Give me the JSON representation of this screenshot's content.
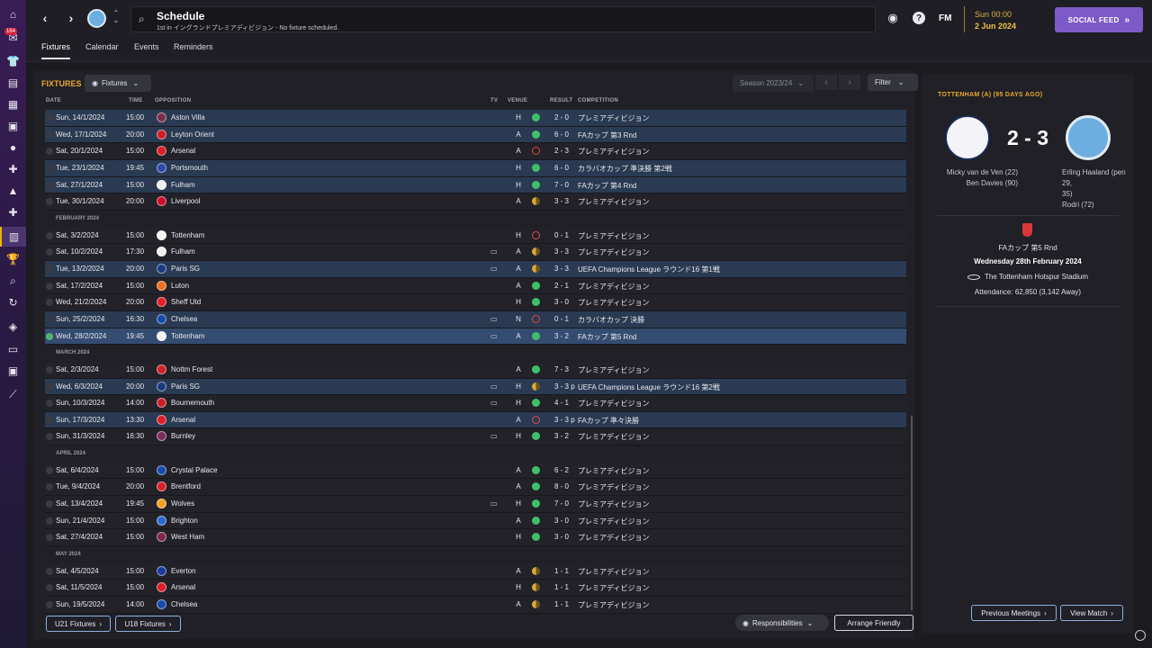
{
  "topbar": {
    "title": "Schedule",
    "subtitle": "1st in イングランドプレミアディビジョン - No fixture scheduled.",
    "fm_logo": "FM",
    "time": "Sun 00:00",
    "date": "2 Jun 2024",
    "social_feed": "SOCIAL FEED"
  },
  "rail": {
    "badge": "164"
  },
  "tabs": [
    "Fixtures",
    "Calendar",
    "Events",
    "Reminders"
  ],
  "fixtures": {
    "section_title": "FIXTURES",
    "view_dropdown": "Fixtures",
    "season": "Season 2023/24",
    "filter": "Filter",
    "columns": {
      "date": "DATE",
      "time": "TIME",
      "opposition": "OPPOSITION",
      "tv": "TV",
      "venue": "VENUE",
      "result": "RESULT",
      "competition": "COMPETITION"
    },
    "rows": [
      {
        "kind": "cup",
        "date": "Sun, 14/1/2024",
        "time": "15:00",
        "opp": "Aston Villa",
        "crest": "#7a2e4a",
        "tv": "",
        "venue": "H",
        "res": "w",
        "score": "2 - 0",
        "comp": "プレミアディビジョン"
      },
      {
        "kind": "cup",
        "date": "Wed, 17/1/2024",
        "time": "20:00",
        "opp": "Leyton Orient",
        "crest": "#c8202a",
        "tv": "",
        "venue": "A",
        "res": "w",
        "score": "6 - 0",
        "comp": "FAカップ 第3 Rnd"
      },
      {
        "kind": "norm",
        "date": "Sat, 20/1/2024",
        "time": "15:00",
        "opp": "Arsenal",
        "crest": "#d8202a",
        "tv": "",
        "venue": "A",
        "res": "l",
        "score": "2 - 3",
        "comp": "プレミアディビジョン"
      },
      {
        "kind": "cup",
        "date": "Tue, 23/1/2024",
        "time": "19:45",
        "opp": "Portsmouth",
        "crest": "#2a4aa8",
        "tv": "",
        "venue": "H",
        "res": "w",
        "score": "6 - 0",
        "comp": "カラバオカップ 準決勝 第2戦"
      },
      {
        "kind": "cup",
        "date": "Sat, 27/1/2024",
        "time": "15:00",
        "opp": "Fulham",
        "crest": "#f0f0f0",
        "tv": "",
        "venue": "H",
        "res": "w",
        "score": "7 - 0",
        "comp": "FAカップ 第4 Rnd"
      },
      {
        "kind": "norm",
        "date": "Tue, 30/1/2024",
        "time": "20:00",
        "opp": "Liverpool",
        "crest": "#c8102e",
        "tv": "",
        "venue": "A",
        "res": "d",
        "score": "3 - 3",
        "comp": "プレミアディビジョン"
      },
      {
        "kind": "month",
        "date": "FEBRUARY 2024"
      },
      {
        "kind": "norm",
        "date": "Sat, 3/2/2024",
        "time": "15:00",
        "opp": "Tottenham",
        "crest": "#f4f4f4",
        "tv": "",
        "venue": "H",
        "res": "l",
        "score": "0 - 1",
        "comp": "プレミアディビジョン"
      },
      {
        "kind": "norm",
        "date": "Sat, 10/2/2024",
        "time": "17:30",
        "opp": "Fulham",
        "crest": "#f0f0f0",
        "tv": "▭",
        "venue": "A",
        "res": "d",
        "score": "3 - 3",
        "comp": "プレミアディビジョン"
      },
      {
        "kind": "cup",
        "date": "Tue, 13/2/2024",
        "time": "20:00",
        "opp": "Paris SG",
        "crest": "#1a3a80",
        "tv": "▭",
        "venue": "A",
        "res": "d",
        "score": "3 - 3",
        "comp": "UEFA Champions League ラウンド16 第1戦"
      },
      {
        "kind": "norm",
        "date": "Sat, 17/2/2024",
        "time": "15:00",
        "opp": "Luton",
        "crest": "#f07020",
        "tv": "",
        "venue": "A",
        "res": "w",
        "score": "2 - 1",
        "comp": "プレミアディビジョン"
      },
      {
        "kind": "norm",
        "date": "Wed, 21/2/2024",
        "time": "20:00",
        "opp": "Sheff Utd",
        "crest": "#e0202a",
        "tv": "",
        "venue": "H",
        "res": "w",
        "score": "3 - 0",
        "comp": "プレミアディビジョン"
      },
      {
        "kind": "cup",
        "date": "Sun, 25/2/2024",
        "time": "16:30",
        "opp": "Chelsea",
        "crest": "#1a4aa8",
        "tv": "▭",
        "venue": "N",
        "res": "l",
        "score": "0 - 1",
        "comp": "カラバオカップ 決勝"
      },
      {
        "kind": "sel",
        "date": "Wed, 28/2/2024",
        "time": "19:45",
        "opp": "Tottenham",
        "crest": "#f4f4f4",
        "tv": "▭",
        "venue": "A",
        "res": "w",
        "score": "3 - 2",
        "comp": "FAカップ 第5 Rnd"
      },
      {
        "kind": "month",
        "date": "MARCH 2024"
      },
      {
        "kind": "norm",
        "date": "Sat, 2/3/2024",
        "time": "15:00",
        "opp": "Nottm Forest",
        "crest": "#d0202a",
        "tv": "",
        "venue": "A",
        "res": "w",
        "score": "7 - 3",
        "comp": "プレミアディビジョン"
      },
      {
        "kind": "cup",
        "date": "Wed, 6/3/2024",
        "time": "20:00",
        "opp": "Paris SG",
        "crest": "#1a3a80",
        "tv": "▭",
        "venue": "H",
        "res": "d",
        "score": "3 - 3 p",
        "comp": "UEFA Champions League ラウンド16 第2戦"
      },
      {
        "kind": "norm",
        "date": "Sun, 10/3/2024",
        "time": "14:00",
        "opp": "Bournemouth",
        "crest": "#c8202a",
        "tv": "▭",
        "venue": "H",
        "res": "w",
        "score": "4 - 1",
        "comp": "プレミアディビジョン"
      },
      {
        "kind": "cup",
        "date": "Sun, 17/3/2024",
        "time": "13:30",
        "opp": "Arsenal",
        "crest": "#d8202a",
        "tv": "",
        "venue": "A",
        "res": "l",
        "score": "3 - 3 p",
        "comp": "FAカップ 準々決勝"
      },
      {
        "kind": "norm",
        "date": "Sun, 31/3/2024",
        "time": "16:30",
        "opp": "Burnley",
        "crest": "#7a2e5a",
        "tv": "▭",
        "venue": "H",
        "res": "w",
        "score": "3 - 2",
        "comp": "プレミアディビジョン"
      },
      {
        "kind": "month",
        "date": "APRIL 2024"
      },
      {
        "kind": "norm",
        "date": "Sat, 6/4/2024",
        "time": "15:00",
        "opp": "Crystal Palace",
        "crest": "#1a4aa8",
        "tv": "",
        "venue": "A",
        "res": "w",
        "score": "6 - 2",
        "comp": "プレミアディビジョン"
      },
      {
        "kind": "norm",
        "date": "Tue, 9/4/2024",
        "time": "20:00",
        "opp": "Brentford",
        "crest": "#d8202a",
        "tv": "",
        "venue": "A",
        "res": "w",
        "score": "8 - 0",
        "comp": "プレミアディビジョン"
      },
      {
        "kind": "norm",
        "date": "Sat, 13/4/2024",
        "time": "19:45",
        "opp": "Wolves",
        "crest": "#f0a020",
        "tv": "▭",
        "venue": "H",
        "res": "w",
        "score": "7 - 0",
        "comp": "プレミアディビジョン"
      },
      {
        "kind": "norm",
        "date": "Sun, 21/4/2024",
        "time": "15:00",
        "opp": "Brighton",
        "crest": "#2a6ad0",
        "tv": "",
        "venue": "A",
        "res": "w",
        "score": "3 - 0",
        "comp": "プレミアディビジョン"
      },
      {
        "kind": "norm",
        "date": "Sat, 27/4/2024",
        "time": "15:00",
        "opp": "West Ham",
        "crest": "#7a2a4a",
        "tv": "",
        "venue": "H",
        "res": "w",
        "score": "3 - 0",
        "comp": "プレミアディビジョン"
      },
      {
        "kind": "month",
        "date": "MAY 2024"
      },
      {
        "kind": "norm",
        "date": "Sat, 4/5/2024",
        "time": "15:00",
        "opp": "Everton",
        "crest": "#1a3aa0",
        "tv": "",
        "venue": "A",
        "res": "d",
        "score": "1 - 1",
        "comp": "プレミアディビジョン"
      },
      {
        "kind": "norm",
        "date": "Sat, 11/5/2024",
        "time": "15:00",
        "opp": "Arsenal",
        "crest": "#d8202a",
        "tv": "",
        "venue": "H",
        "res": "d",
        "score": "1 - 1",
        "comp": "プレミアディビジョン"
      },
      {
        "kind": "norm",
        "date": "Sun, 19/5/2024",
        "time": "14:00",
        "opp": "Chelsea",
        "crest": "#1a4aa8",
        "tv": "",
        "venue": "A",
        "res": "d",
        "score": "1 - 1",
        "comp": "プレミアディビジョン"
      }
    ],
    "u21": "U21 Fixtures",
    "u18": "U18 Fixtures",
    "responsibilities": "Responsibilities",
    "arrange_friendly": "Arrange Friendly"
  },
  "match": {
    "title": "TOTTENHAM (A) (95 DAYS AGO)",
    "score": "2 - 3",
    "home_scorers": [
      "Micky van de Ven (22)",
      "Ben Davies (90)"
    ],
    "away_scorers": [
      "Erling Haaland (pen 29,",
      "35)",
      "Rodri (72)"
    ],
    "competition": "FAカップ 第5 Rnd",
    "date": "Wednesday 28th February 2024",
    "stadium": "The Tottenham Hotspur Stadium",
    "attendance": "Attendance: 62,850 (3,142 Away)",
    "prev_meetings": "Previous Meetings",
    "view_match": "View Match"
  },
  "colors": {
    "accent": "#e8a830",
    "brand": "#7e5ac8",
    "win": "#3fbf6a",
    "loss": "#e04848",
    "draw": "#e0a830"
  }
}
